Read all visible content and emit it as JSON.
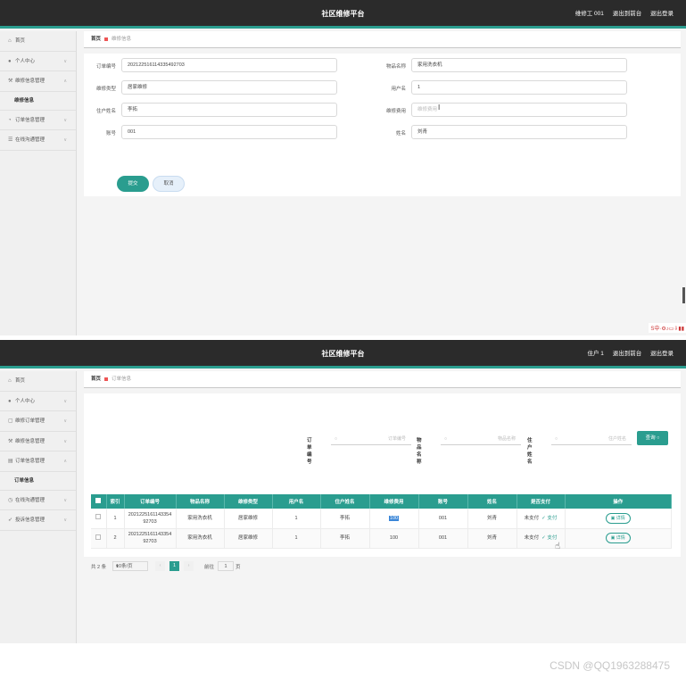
{
  "app": {
    "title": "社区维修平台"
  },
  "panel1": {
    "header_right": [
      "维修工 001",
      "退出到前台",
      "退出登录"
    ],
    "sidebar": [
      {
        "label": "首页",
        "icon": "home-icon"
      },
      {
        "label": "个人中心",
        "icon": "user-icon"
      },
      {
        "label": "维修信息管理",
        "icon": "wrench-icon",
        "expanded": true
      },
      {
        "label": "维修信息",
        "submenu": true
      },
      {
        "label": "订单信息管理",
        "icon": "order-icon"
      },
      {
        "label": "在线沟通管理",
        "icon": "chat-icon"
      }
    ],
    "breadcrumb": {
      "home": "首页",
      "current": "维修信息"
    },
    "form": {
      "order_no": {
        "label": "订单编号",
        "value": "202122516114335492703"
      },
      "item_name": {
        "label": "物品名称",
        "value": "家用洗衣机"
      },
      "repair_type": {
        "label": "维修类型",
        "value": "居家维修"
      },
      "username": {
        "label": "用户名",
        "value": "1"
      },
      "resident_name": {
        "label": "住户姓名",
        "value": "李拓"
      },
      "repair_fee": {
        "label": "维修费用",
        "placeholder": "维修费用"
      },
      "account": {
        "label": "账号",
        "value": "001"
      },
      "name": {
        "label": "姓名",
        "value": "刘青"
      },
      "submit": "提交",
      "cancel": "取消"
    }
  },
  "panel2": {
    "header_right": [
      "住户 1",
      "退出到前台",
      "退出登录"
    ],
    "sidebar": [
      {
        "label": "首页",
        "icon": "home-icon"
      },
      {
        "label": "个人中心",
        "icon": "user-icon"
      },
      {
        "label": "维修订单管理",
        "icon": "order-icon"
      },
      {
        "label": "维修信息管理",
        "icon": "wrench-icon"
      },
      {
        "label": "订单信息管理",
        "icon": "order-icon",
        "expanded": true
      },
      {
        "label": "订单信息",
        "submenu": true
      },
      {
        "label": "在线沟通管理",
        "icon": "chat-icon"
      },
      {
        "label": "投诉信息管理",
        "icon": "send-icon"
      }
    ],
    "breadcrumb": {
      "home": "首页",
      "current": "订单信息"
    },
    "search": {
      "order_no": {
        "label": "订单编号",
        "placeholder": "订单编号"
      },
      "item_name": {
        "label": "物品名称",
        "placeholder": "物品名称"
      },
      "resident_name": {
        "label": "住户姓名",
        "placeholder": "住户姓名"
      },
      "button": "查询"
    },
    "table": {
      "headers": [
        "索引",
        "订单编号",
        "物品名称",
        "维修类型",
        "用户名",
        "住户姓名",
        "维修费用",
        "账号",
        "姓名",
        "是否支付",
        "操作"
      ],
      "rows": [
        {
          "index": "1",
          "order_no": "202122516114335492703",
          "item": "家用洗衣机",
          "type": "居家维修",
          "user": "1",
          "resident": "李拓",
          "fee": "100",
          "account": "001",
          "name": "刘青",
          "paid": "未支付",
          "pay": "支付",
          "op": "详情"
        },
        {
          "index": "2",
          "order_no": "202122516114335492703",
          "item": "家用洗衣机",
          "type": "居家维修",
          "user": "1",
          "resident": "李拓",
          "fee": "100",
          "account": "001",
          "name": "刘青",
          "paid": "未支付",
          "pay": "支付",
          "op": "详情"
        }
      ]
    },
    "pager": {
      "total": "共 2 条",
      "page_size": "10条/页",
      "current": "1",
      "goto": "前往",
      "goto_value": "1",
      "page_unit": "页"
    }
  },
  "watermark": "CSDN @QQ1963288475",
  "colors": {
    "accent": "#2a9d8f",
    "header": "#2b2b2b"
  }
}
